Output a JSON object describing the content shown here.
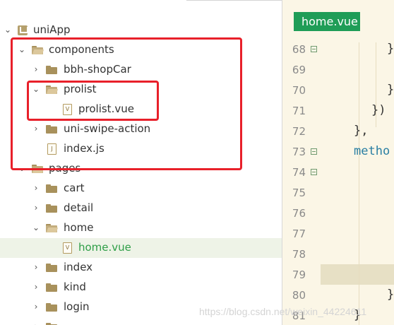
{
  "project": {
    "name": "uniApp"
  },
  "tree": {
    "components": "components",
    "bbh_shopCar": "bbh-shopCar",
    "prolist": "prolist",
    "prolist_vue": "prolist.vue",
    "uni_swipe_action": "uni-swipe-action",
    "index_js": "index.js",
    "pages": "pages",
    "cart": "cart",
    "detail": "detail",
    "home": "home",
    "home_vue": "home.vue",
    "index": "index",
    "kind": "kind",
    "login": "login"
  },
  "icons": {
    "vue_file": "V",
    "js_file": "J"
  },
  "editor": {
    "active_tab": "home.vue",
    "line_numbers": [
      "68",
      "69",
      "70",
      "71",
      "72",
      "73",
      "74",
      "75",
      "76",
      "77",
      "78",
      "79",
      "80",
      "81"
    ],
    "code": {
      "l68": "}",
      "l70": "}",
      "l71": "})",
      "l72": "},",
      "l73": "metho",
      "l80": "}",
      "l81": "}"
    }
  },
  "watermark": "https://blog.csdn.net/weixin_44224611",
  "colors": {
    "selected_text": "#2e9e47",
    "tab_bg": "#1f9d57",
    "annotation_red": "#e8202a",
    "editor_bg": "#fbf6e6"
  }
}
